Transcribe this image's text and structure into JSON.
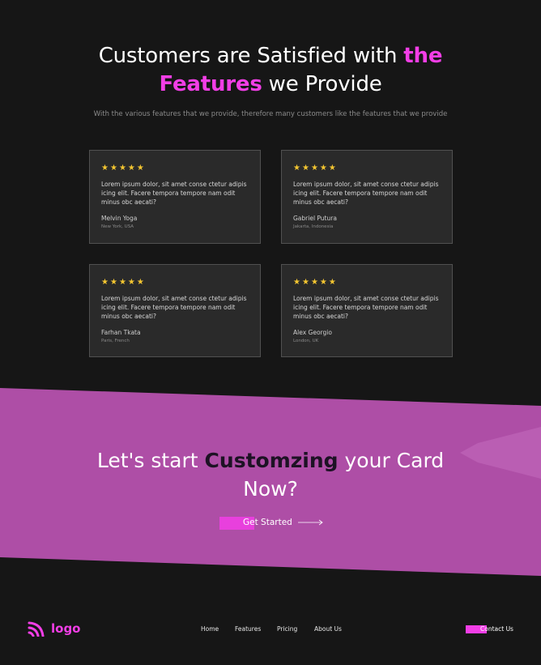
{
  "testimonials": {
    "title_part1": "Customers are Satisfied with ",
    "title_highlight1": "the",
    "title_highlight2": "Features",
    "title_part2": " we Provide",
    "subtitle": "With the various features that we provide, therefore many customers like the features that we provide",
    "rating_icon": "star-icon",
    "rating": 5,
    "cards": [
      {
        "quote": "Lorem ipsum dolor, sit amet conse ctetur adipis icing elit. Facere tempora tempore nam odit minus obc aecati?",
        "name": "Melvin Yoga",
        "location": "New York, USA"
      },
      {
        "quote": "Lorem ipsum dolor, sit amet conse ctetur adipis icing elit. Facere tempora tempore nam odit minus obc aecati?",
        "name": "Gabriel Putura",
        "location": "Jakarta, Indonesia"
      },
      {
        "quote": "Lorem ipsum dolor, sit amet conse ctetur adipis icing elit. Facere tempora tempore nam odit minus obc aecati?",
        "name": "Farhan Tkata",
        "location": "Paris, French"
      },
      {
        "quote": "Lorem ipsum dolor, sit amet conse ctetur adipis icing elit. Facere tempora tempore nam odit minus obc aecati?",
        "name": "Alex Georgio",
        "location": "London, UK"
      }
    ]
  },
  "cta": {
    "title_part1": "Let's start ",
    "title_dark": "Customzing",
    "title_part2": " your Card",
    "title_line2": "Now?",
    "button_label": "Get Started",
    "arrow_icon": "arrow-right-icon"
  },
  "footer": {
    "logo_icon": "rss-icon",
    "logo_text": "logo",
    "nav": [
      "Home",
      "Features",
      "Pricing",
      "About Us"
    ],
    "contact_label": "Contact Us"
  },
  "colors": {
    "background": "#161616",
    "accent": "#f23ee6",
    "band": "#ae4ea6",
    "card": "#2a2a2a",
    "star": "#f4c631"
  }
}
